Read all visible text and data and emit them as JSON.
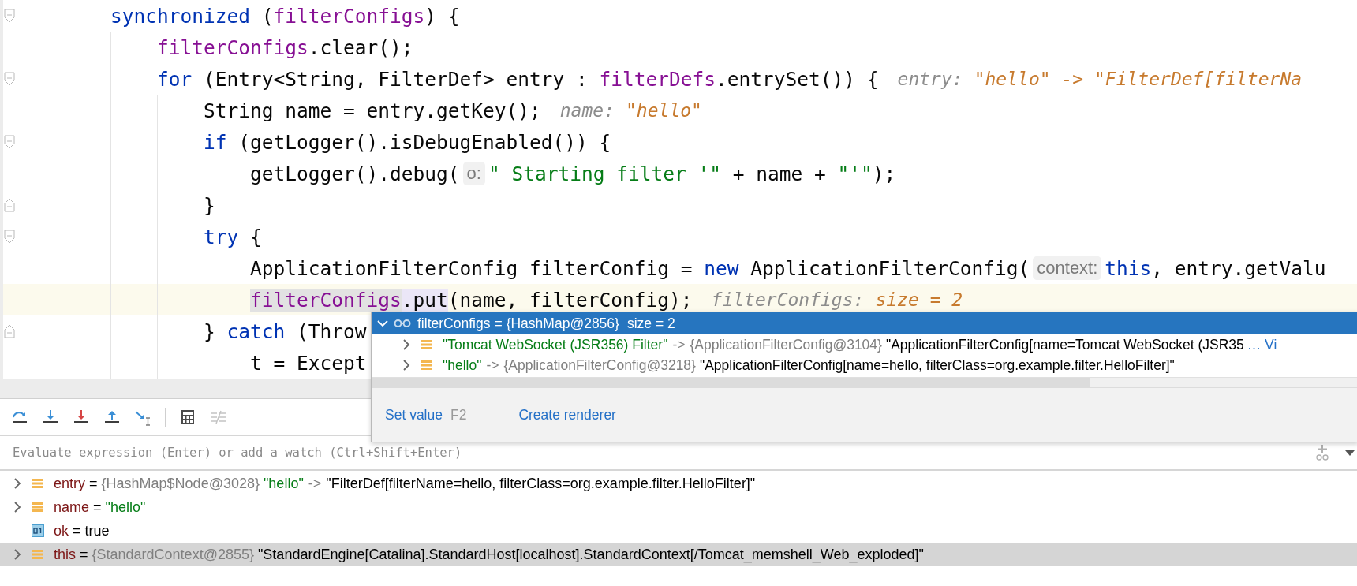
{
  "editor": {
    "lines": [
      {
        "kind": "block-start",
        "current": false,
        "tokens": [
          {
            "kind": "kw",
            "t": "synchronized"
          },
          {
            "kind": "plain",
            "t": " ("
          },
          {
            "kind": "field",
            "t": "filterConfigs"
          },
          {
            "kind": "plain",
            "t": ") {"
          }
        ],
        "children": [
          {
            "kind": "statement",
            "current": false,
            "tokens": [
              {
                "kind": "field",
                "t": "filterConfigs"
              },
              {
                "kind": "plain",
                "t": ".clear();"
              }
            ]
          },
          {
            "kind": "block-start",
            "current": false,
            "tokens": [
              {
                "kind": "kw",
                "t": "for"
              },
              {
                "kind": "plain",
                "t": " (Entry<String, FilterDef> entry : "
              },
              {
                "kind": "field",
                "t": "filterDefs"
              },
              {
                "kind": "plain",
                "t": ".entrySet()) {"
              },
              {
                "kind": "hint-name",
                "t": "entry:"
              },
              {
                "kind": "hint-value",
                "t": "\"hello\" -> \"FilterDef[filterNa"
              }
            ],
            "children": [
              {
                "kind": "statement",
                "current": false,
                "tokens": [
                  {
                    "kind": "plain",
                    "t": "String name = entry.getKey();"
                  },
                  {
                    "kind": "hint-name",
                    "t": "name:"
                  },
                  {
                    "kind": "hint-value",
                    "t": "\"hello\""
                  }
                ]
              },
              {
                "kind": "block-start",
                "current": false,
                "tokens": [
                  {
                    "kind": "kw",
                    "t": "if"
                  },
                  {
                    "kind": "plain",
                    "t": " (getLogger().isDebugEnabled()) {"
                  }
                ],
                "children": [
                  {
                    "kind": "statement",
                    "current": false,
                    "tokens": [
                      {
                        "kind": "plain",
                        "t": "getLogger().debug("
                      },
                      {
                        "kind": "param",
                        "t": "o:"
                      },
                      {
                        "kind": "str",
                        "t": "\" Starting filter '\""
                      },
                      {
                        "kind": "plain",
                        "t": " + name + "
                      },
                      {
                        "kind": "str",
                        "t": "\"'\""
                      },
                      {
                        "kind": "plain",
                        "t": ");"
                      }
                    ]
                  }
                ]
              },
              {
                "kind": "block-end",
                "current": false,
                "tokens": [
                  {
                    "kind": "plain",
                    "t": "}"
                  }
                ]
              },
              {
                "kind": "block-start",
                "current": false,
                "tokens": [
                  {
                    "kind": "kw",
                    "t": "try"
                  },
                  {
                    "kind": "plain",
                    "t": " {"
                  }
                ],
                "children": [
                  {
                    "kind": "statement",
                    "current": false,
                    "tokens": [
                      {
                        "kind": "plain",
                        "t": "ApplicationFilterConfig filterConfig = "
                      },
                      {
                        "kind": "kw",
                        "t": "new"
                      },
                      {
                        "kind": "plain",
                        "t": " ApplicationFilterConfig("
                      },
                      {
                        "kind": "param",
                        "t": "context:"
                      },
                      {
                        "kind": "kw",
                        "t": "this"
                      },
                      {
                        "kind": "plain",
                        "t": ", entry.getValu"
                      }
                    ]
                  },
                  {
                    "kind": "statement",
                    "current": true,
                    "tokens": [
                      {
                        "kind": "field-hl",
                        "t": "filterConfigs"
                      },
                      {
                        "kind": "hl",
                        "t": ".put"
                      },
                      {
                        "kind": "plain",
                        "t": "(name, filterConfig);"
                      },
                      {
                        "kind": "hint-name",
                        "t": "filterConfigs:"
                      },
                      {
                        "kind": "hint-value",
                        "t": "size = 2"
                      }
                    ]
                  }
                ]
              },
              {
                "kind": "block-end",
                "current": false,
                "tokens": [
                  {
                    "kind": "plain",
                    "t": "} "
                  },
                  {
                    "kind": "kw",
                    "t": "catch"
                  },
                  {
                    "kind": "plain",
                    "t": " (Throw"
                  }
                ],
                "children": [
                  {
                    "kind": "statement",
                    "current": false,
                    "tokens": [
                      {
                        "kind": "plain",
                        "t": "t = Except"
                      }
                    ]
                  }
                ]
              }
            ]
          }
        ]
      }
    ]
  },
  "debugger": {
    "toolbar": [
      [
        {
          "kind": "step-over",
          "disabled": false
        },
        {
          "kind": "step-into",
          "disabled": false
        },
        {
          "kind": "force-step-into",
          "disabled": false
        },
        {
          "kind": "step-out",
          "disabled": false
        },
        {
          "kind": "run-to-cursor",
          "disabled": false
        }
      ],
      [
        {
          "kind": "evaluate",
          "disabled": false
        },
        {
          "kind": "trace",
          "disabled": true
        }
      ]
    ],
    "watch": {
      "placeholder": "Evaluate expression (Enter) or add a watch (Ctrl+Shift+Enter)"
    },
    "variables": [
      {
        "kind": "object",
        "expanded": false,
        "selected": false,
        "parts": [
          {
            "kind": "name",
            "t": "entry"
          },
          {
            "kind": "op",
            "t": "="
          },
          {
            "kind": "type",
            "t": "{HashMap$Node@3028}"
          },
          {
            "kind": "str",
            "t": "\"hello\""
          },
          {
            "kind": "arrow",
            "t": "->"
          },
          {
            "kind": "plain",
            "t": "\"FilterDef[filterName=hello, filterClass=org.example.filter.HelloFilter]\""
          }
        ]
      },
      {
        "kind": "object",
        "expanded": false,
        "selected": false,
        "parts": [
          {
            "kind": "name",
            "t": "name"
          },
          {
            "kind": "op",
            "t": "="
          },
          {
            "kind": "str",
            "t": "\"hello\""
          }
        ]
      },
      {
        "kind": "primitive",
        "selected": false,
        "parts": [
          {
            "kind": "name",
            "t": "ok"
          },
          {
            "kind": "op",
            "t": "="
          },
          {
            "kind": "plain",
            "t": "true"
          }
        ]
      },
      {
        "kind": "object",
        "expanded": false,
        "selected": true,
        "parts": [
          {
            "kind": "name",
            "t": "this"
          },
          {
            "kind": "op",
            "t": "="
          },
          {
            "kind": "type",
            "t": "{StandardContext@2855}"
          },
          {
            "kind": "plain",
            "t": "\"StandardEngine[Catalina].StandardHost[localhost].StandardContext[/Tomcat_memshell_Web_exploded]\""
          }
        ]
      }
    ]
  },
  "popup": {
    "header": {
      "kind": "watch",
      "expanded": true,
      "selected": true,
      "parts": [
        {
          "kind": "name",
          "t": "filterConfigs"
        },
        {
          "kind": "op",
          "t": "="
        },
        {
          "kind": "type",
          "t": "{HashMap@2856}"
        },
        {
          "kind": "plain",
          "t": "size = 2"
        }
      ]
    },
    "rows": [
      {
        "kind": "object",
        "expanded": false,
        "selected": false,
        "parts": [
          {
            "kind": "str",
            "t": "\"Tomcat WebSocket (JSR356) Filter\""
          },
          {
            "kind": "arrow",
            "t": "->"
          },
          {
            "kind": "type",
            "t": "{ApplicationFilterConfig@3104}"
          },
          {
            "kind": "plain",
            "t": "\"ApplicationFilterConfig[name=Tomcat WebSocket (JSR35"
          },
          {
            "kind": "link",
            "t": "… Vi"
          }
        ]
      },
      {
        "kind": "object",
        "expanded": false,
        "selected": false,
        "parts": [
          {
            "kind": "str",
            "t": "\"hello\""
          },
          {
            "kind": "arrow",
            "t": "->"
          },
          {
            "kind": "type",
            "t": "{ApplicationFilterConfig@3218}"
          },
          {
            "kind": "plain",
            "t": "\"ApplicationFilterConfig[name=hello, filterClass=org.example.filter.HelloFilter]\""
          }
        ]
      }
    ],
    "actions": [
      {
        "label": "Set value",
        "shortcut": "F2"
      },
      {
        "label": "Create renderer"
      }
    ]
  }
}
